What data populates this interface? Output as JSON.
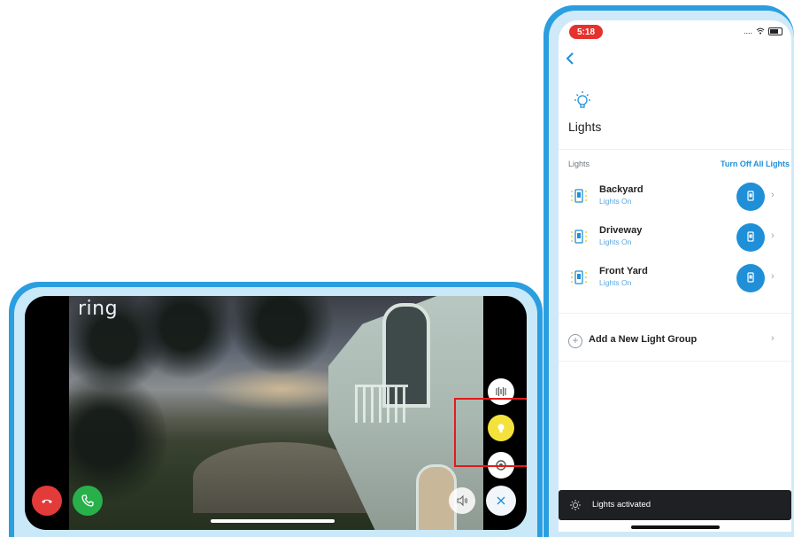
{
  "live_view": {
    "brand_logo": "ring",
    "buttons": {
      "decline": "decline-call",
      "accept": "accept-call",
      "motion": "motion-detect",
      "light": "lights-toggle",
      "siren": "siren",
      "mute": "speaker-mute",
      "close": "close"
    }
  },
  "lights_app": {
    "status_time": "5:18",
    "page_title": "Lights",
    "section_label": "Lights",
    "turn_off_all": "Turn Off All Lights",
    "groups": [
      {
        "name": "Backyard",
        "status": "Lights On"
      },
      {
        "name": "Driveway",
        "status": "Lights On"
      },
      {
        "name": "Front Yard",
        "status": "Lights On"
      }
    ],
    "add_group_label": "Add a New Light Group",
    "toast_message": "Lights activated"
  },
  "colors": {
    "accent_blue": "#1f8fd8",
    "frame_blue": "#2a9ee0",
    "decline_red": "#e33a3a",
    "accept_green": "#28b04a",
    "light_yellow": "#f4e23c",
    "highlight_red": "#e21b1b"
  }
}
